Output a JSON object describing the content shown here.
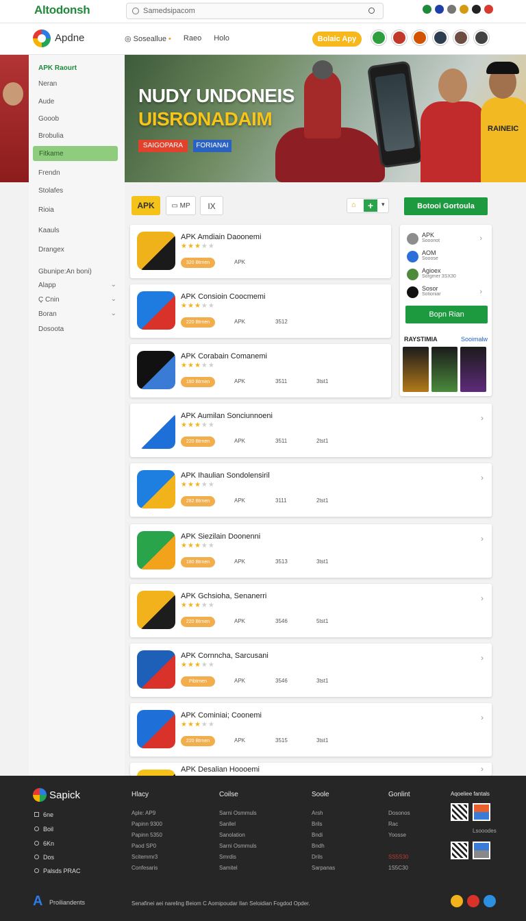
{
  "top": {
    "brand": "Altodonsh",
    "search_placeholder": "Samedsipacom",
    "icon_colors": [
      "#1f8a3b",
      "#1f3fa8",
      "#777777",
      "#d69a12",
      "#222222",
      "#d73a2f"
    ]
  },
  "nav": {
    "logo_text": "Apdne",
    "items": [
      "Soseallue",
      "Raeo",
      "Holo"
    ],
    "cta": "Bolaic Apy",
    "avatar_colors": [
      "#2e9e3f",
      "#c0392b",
      "#d35400",
      "#2c3e50",
      "#6d4c41",
      "#424242"
    ]
  },
  "sidebar": {
    "title": "APK Raourt",
    "items": [
      "Neran",
      "Aude",
      "Gooob",
      "Brobulia",
      "Fitkame",
      "Frendn",
      "Stolafes",
      "Rioia",
      "Kaauls",
      "Drangex"
    ],
    "active_index": 4,
    "section_title": "Gbunipe:An boni)",
    "sub_items": [
      "Alapp",
      "Ç Cnin",
      "Boran",
      "Dosoota"
    ]
  },
  "hero": {
    "title_line1": "NUDY UNDONEIS",
    "title_line2": "UISRONADAIM",
    "badge1": "SAIGOPARA",
    "badge2": "FORIANAI",
    "shirt_text": "RAINEIC"
  },
  "filters": {
    "tab_active": "APK",
    "tab2": "MP",
    "tab3": "IX",
    "download_button": "Botooi Gortoula"
  },
  "apps": [
    {
      "name": "APK Amdiain Daoonemi",
      "rating": 3,
      "pill": "320 Btrnen",
      "meta": [
        "APK",
        "",
        ""
      ],
      "icon": "a-logo-icon",
      "colors": [
        "#f0b21b",
        "#1a1a1a"
      ]
    },
    {
      "name": "APK Consioin Coocmemi",
      "rating": 3,
      "pill": "220 Btrnen",
      "meta": [
        "APK",
        "3512",
        ""
      ],
      "icon": "feather-logo-icon",
      "colors": [
        "#1e7be0",
        "#d8322a"
      ]
    },
    {
      "name": "APK Corabain Comanemi",
      "rating": 3,
      "pill": "180 Btrnen",
      "meta": [
        "APK",
        "3511",
        "3tst1"
      ],
      "icon": "spiral-logo-icon",
      "colors": [
        "#111111",
        "#3a7bd5"
      ]
    },
    {
      "name": "APK Aumilan Sonciunnoeni",
      "rating": 3,
      "pill": "220 Btrnen",
      "meta": [
        "APK",
        "3511",
        "2tst1"
      ],
      "icon": "blue-a-icon",
      "colors": [
        "#ffffff",
        "#1e6fd8"
      ]
    },
    {
      "name": "APK Ihaulian Sondolensiril",
      "rating": 3,
      "pill": "282 Btrnen",
      "meta": [
        "APK",
        "3111",
        "2tst1"
      ],
      "icon": "wing-logo-icon",
      "colors": [
        "#1f7fe0",
        "#f2b21c"
      ]
    },
    {
      "name": "APK Siezilain Doonenni",
      "rating": 3,
      "pill": "180 Btrnen",
      "meta": [
        "APK",
        "3513",
        "3tst1"
      ],
      "icon": "camera-logo-icon",
      "colors": [
        "#2aa44a",
        "#f2a31b"
      ]
    },
    {
      "name": "APK Gchsioha, Senanerri",
      "rating": 3,
      "pill": "220 Btrnen",
      "meta": [
        "APK",
        "3546",
        "5tst1"
      ],
      "icon": "badge-logo-icon",
      "colors": [
        "#f2b21c",
        "#1d1d1d"
      ]
    },
    {
      "name": "APK Cornncha, Sarcusani",
      "rating": 3,
      "pill": "Pibtrnen",
      "meta": [
        "APK",
        "3546",
        "3tst1"
      ],
      "icon": "flag-logo-icon",
      "colors": [
        "#1e5fb8",
        "#d8322a"
      ]
    },
    {
      "name": "APK Cominiai; Coonemi",
      "rating": 3,
      "pill": "220 Btrnen",
      "meta": [
        "APK",
        "3515",
        "3tst1"
      ],
      "icon": "shield-a-icon",
      "colors": [
        "#1e6fd8",
        "#d8322a"
      ]
    },
    {
      "name": "APK Desalian Hoooemi",
      "rating": 3,
      "pill": "",
      "meta": [
        "",
        "",
        ""
      ],
      "icon": "yellow-logo-icon",
      "colors": [
        "#f5c21a",
        "#111111"
      ]
    }
  ],
  "side_panel": {
    "rows": [
      {
        "t1": "APK",
        "t2": "Sooonot",
        "color": "#8d8d8d"
      },
      {
        "t1": "AOM",
        "t2": "Sooose",
        "color": "#2d6fd8"
      },
      {
        "t1": "Agioex",
        "t2": "Sorgmer 3SX30",
        "color": "#4d8b3b"
      },
      {
        "t1": "Sosor",
        "t2": "Sotioniar",
        "color": "#111111"
      }
    ],
    "button": "Bopn Rian",
    "section_title": "RAYSTIMIA",
    "section_link": "Sooimalw",
    "poster_colors": [
      "#b37a1b",
      "#4b8a3c",
      "#5d2b7a"
    ]
  },
  "footer": {
    "logo_text": "Sapick",
    "links": [
      "6ne",
      "Boil",
      "6Kn",
      "Dos",
      "Palsds PRAC"
    ],
    "columns": [
      {
        "heading": "Hlacy",
        "items": [
          "Aple: AP9",
          "Papinn 9300",
          "Papinn 5350",
          "Paod SP0",
          "Scitemmr3",
          "Confesaris"
        ]
      },
      {
        "heading": "Coilse",
        "items": [
          "Sarni Osmmuls",
          "Sanllel",
          "Sanolation",
          "Sarni Osmmuls",
          "Smrdis",
          "Samitel"
        ]
      },
      {
        "heading": "Soole",
        "items": [
          "Arsh",
          "Brils",
          "Bndi",
          "Bndh",
          "Drils",
          "Sarpanas"
        ]
      },
      {
        "heading": "Gonlint",
        "items": [
          "Dosonos",
          "Rac",
          "Yoosse",
          "",
          "SS5S30",
          "1S5C30"
        ]
      }
    ],
    "apps_title": "Aqoeliee fantals",
    "apps_caption": "Lsooodes",
    "bottom_brand": "Proiliandents",
    "copyright": "Senafinei aei nareling Beiom C Aomipoudar Ilan Seloidian Fogdod Opder.",
    "social_colors": [
      "#f2b21c",
      "#d8322a",
      "#2d8fe0"
    ]
  }
}
